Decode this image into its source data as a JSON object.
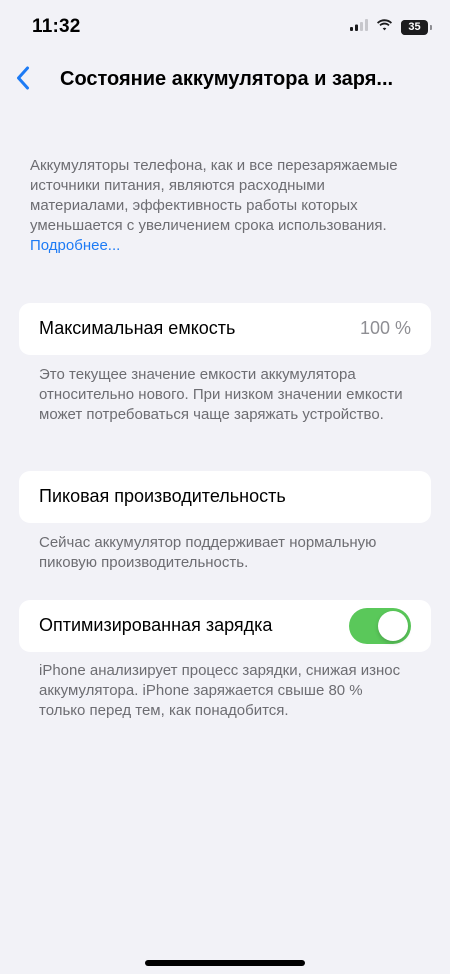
{
  "status_bar": {
    "time": "11:32",
    "battery_level": "35",
    "battery_fraction": 0.35,
    "signal_icon": "cellular-signal-icon",
    "wifi_icon": "wifi-icon"
  },
  "nav": {
    "back_icon": "chevron-left-icon",
    "title": "Состояние аккумулятора и заря..."
  },
  "intro": {
    "text": "Аккумуляторы телефона, как и все перезаряжаемые источники питания, являются расходными материалами, эффективность работы которых уменьшается с увеличением срока использования. ",
    "link": "Подробнее..."
  },
  "max_capacity": {
    "label": "Максимальная емкость",
    "value": "100 %",
    "footnote": "Это текущее значение емкости аккумулятора относительно нового. При низком значении емкости может потребоваться чаще заряжать устройство."
  },
  "peak_performance": {
    "label": "Пиковая производительность",
    "footnote": "Сейчас аккумулятор поддерживает нормальную пиковую производительность."
  },
  "optimized_charging": {
    "label": "Оптимизированная зарядка",
    "enabled": true,
    "footnote": "iPhone анализирует процесс зарядки, снижая износ аккумулятора. iPhone заряжается свыше 80 % только перед тем, как понадобится."
  },
  "colors": {
    "accent": "#1d7bf5",
    "toggle_on": "#5ac85a",
    "background": "#f2f2f7",
    "secondary_text": "#6d6d72"
  }
}
